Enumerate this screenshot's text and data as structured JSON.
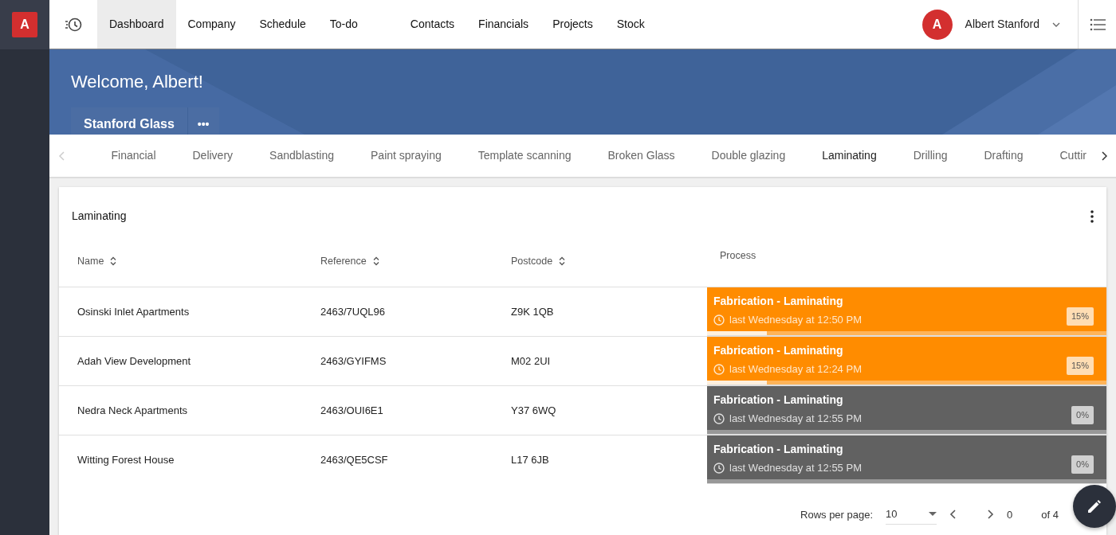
{
  "logo": {
    "letter": "A"
  },
  "nav": [
    {
      "label": "Dashboard",
      "selected": true
    },
    {
      "label": "Company",
      "selected": false
    },
    {
      "label": "Schedule",
      "selected": false
    },
    {
      "label": "To-do",
      "selected": false
    },
    {
      "label": "Contacts",
      "selected": false
    },
    {
      "label": "Financials",
      "selected": false
    },
    {
      "label": "Projects",
      "selected": false
    },
    {
      "label": "Stock",
      "selected": false
    }
  ],
  "user": {
    "initial": "A",
    "name": "Albert Stanford"
  },
  "banner": {
    "welcome": "Welcome, Albert!",
    "company": "Stanford Glass",
    "more": "•••"
  },
  "tabs": [
    {
      "label": "Financial",
      "selected": false
    },
    {
      "label": "Delivery",
      "selected": false
    },
    {
      "label": "Sandblasting",
      "selected": false
    },
    {
      "label": "Paint spraying",
      "selected": false
    },
    {
      "label": "Template scanning",
      "selected": false
    },
    {
      "label": "Broken Glass",
      "selected": false
    },
    {
      "label": "Double glazing",
      "selected": false
    },
    {
      "label": "Laminating",
      "selected": true
    },
    {
      "label": "Drilling",
      "selected": false
    },
    {
      "label": "Drafting",
      "selected": false
    },
    {
      "label": "Cuttir",
      "selected": false
    }
  ],
  "card": {
    "title": "Laminating"
  },
  "table": {
    "columns": [
      {
        "label": "Name",
        "sortable": true
      },
      {
        "label": "Reference",
        "sortable": true
      },
      {
        "label": "Postcode",
        "sortable": true
      },
      {
        "label": "Process",
        "sortable": false
      }
    ],
    "rows": [
      {
        "name": "Osinski Inlet Apartments",
        "reference": "2463/7UQL96",
        "postcode": "Z9K 1QB",
        "process": "Fabrication - Laminating",
        "time": "last Wednesday at 12:50 PM",
        "percent": "15%",
        "level": 0.15,
        "color": "#ff8c00"
      },
      {
        "name": "Adah View Development",
        "reference": "2463/GYIFMS",
        "postcode": "M02 2UI",
        "process": "Fabrication - Laminating",
        "time": "last Wednesday at 12:24 PM",
        "percent": "15%",
        "level": 0.15,
        "color": "#ff8c00"
      },
      {
        "name": "Nedra Neck Apartments",
        "reference": "2463/OUI6E1",
        "postcode": "Y37 6WQ",
        "process": "Fabrication - Laminating",
        "time": "last Wednesday at 12:55 PM",
        "percent": "0%",
        "level": 0,
        "color": "#616161"
      },
      {
        "name": "Witting Forest House",
        "reference": "2463/QE5CSF",
        "postcode": "L17 6JB",
        "process": "Fabrication - Laminating",
        "time": "last Wednesday at 12:55 PM",
        "percent": "0%",
        "level": 0,
        "color": "#616161"
      }
    ]
  },
  "pagination": {
    "rows_label": "Rows per page:",
    "rows_value": "10",
    "range_start": "0",
    "range_end": "of 4"
  }
}
